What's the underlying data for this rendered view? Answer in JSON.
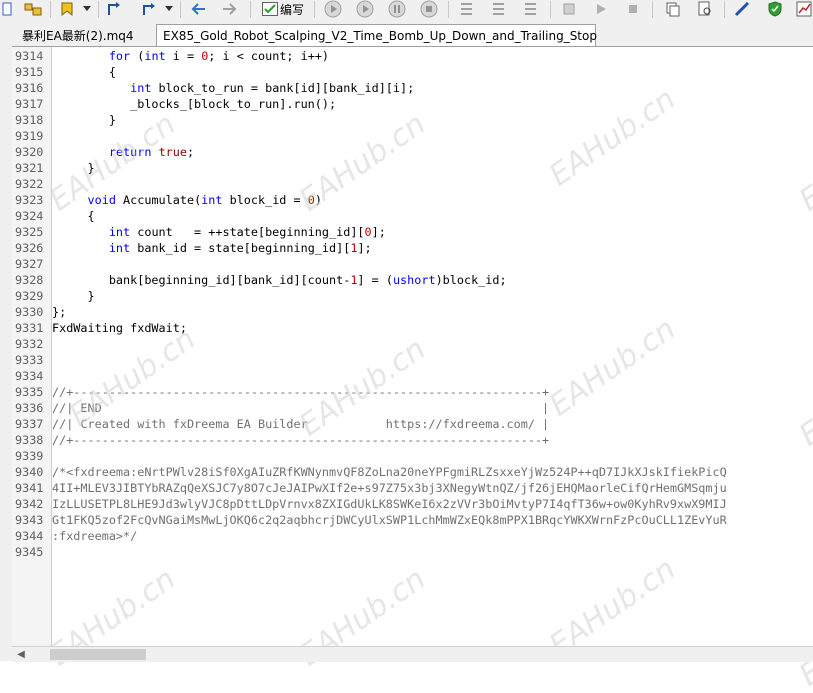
{
  "toolbar": {
    "compile_label": "编写"
  },
  "tabs": [
    {
      "label": "暴利EA最新(2).mq4"
    },
    {
      "label": "EX85_Gold_Robot_Scalping_V2_Time_Bomb_Up_Down_and_Trailing_Stop"
    }
  ],
  "watermark": "EAHub.cn",
  "editor": {
    "lines": [
      {
        "n": "9314",
        "text": "        for (int i = 0; i < count; i++)"
      },
      {
        "n": "9315",
        "text": "        {"
      },
      {
        "n": "9316",
        "text": "           int block_to_run = bank[id][bank_id][i];"
      },
      {
        "n": "9317",
        "text": "           _blocks_[block_to_run].run();"
      },
      {
        "n": "9318",
        "text": "        }"
      },
      {
        "n": "9319",
        "text": ""
      },
      {
        "n": "9320",
        "text": "        return true;"
      },
      {
        "n": "9321",
        "text": "     }"
      },
      {
        "n": "9322",
        "text": ""
      },
      {
        "n": "9323",
        "text": "     void Accumulate(int block_id = 0)"
      },
      {
        "n": "9324",
        "text": "     {"
      },
      {
        "n": "9325",
        "text": "        int count   = ++state[beginning_id][0];"
      },
      {
        "n": "9326",
        "text": "        int bank_id = state[beginning_id][1];"
      },
      {
        "n": "9327",
        "text": ""
      },
      {
        "n": "9328",
        "text": "        bank[beginning_id][bank_id][count-1] = (ushort)block_id;"
      },
      {
        "n": "9329",
        "text": "     }"
      },
      {
        "n": "9330",
        "text": "};"
      },
      {
        "n": "9331",
        "text": "FxdWaiting fxdWait;"
      },
      {
        "n": "9332",
        "text": ""
      },
      {
        "n": "9333",
        "text": ""
      },
      {
        "n": "9334",
        "text": ""
      },
      {
        "n": "9335",
        "text": "//+------------------------------------------------------------------+"
      },
      {
        "n": "9336",
        "text": "//| END                                                              |"
      },
      {
        "n": "9337",
        "text": "//| Created with fxDreema EA Builder           https://fxdreema.com/ |"
      },
      {
        "n": "9338",
        "text": "//+------------------------------------------------------------------+"
      },
      {
        "n": "9339",
        "text": ""
      },
      {
        "n": "9340",
        "text": "/*<fxdreema:eNrtPWlv28iSf0XgAIuZRfKWNynmvQF8ZoLna20neYPFgmiRLZsxxeYjWz524P++qD7IJkXJskIfiekPicQ"
      },
      {
        "n": "9341",
        "text": "4II+MLEV3JIBTYbRAZqQeXSJC7y8O7cJeJAIPwXIf2e+s97Z75x3bj3XNegyWtnQZ/jf26jEHQMaorleCifQrHemGMSqmju"
      },
      {
        "n": "9342",
        "text": "IzLLUSETPL8LHE9Jd3wlyVJC8pDttLDpVrnvx8ZXIGdUkLK8SWKeI6x2zVVr3bOiMvtyP7I4qfT36w+ow0KyhRv9xwX9MIJ"
      },
      {
        "n": "9343",
        "text": "Gt1FKQ5zof2FcQvNGaiMsMwLjOKQ6c2q2aqbhcrjDWCyUlxSWP1LchMmWZxEQk8mPPX1BRqcYWKXWrnFzPcOuCLL1ZEvYuR"
      },
      {
        "n": "9344",
        "text": ":fxdreema>*/"
      },
      {
        "n": "9345",
        "text": ""
      }
    ]
  }
}
